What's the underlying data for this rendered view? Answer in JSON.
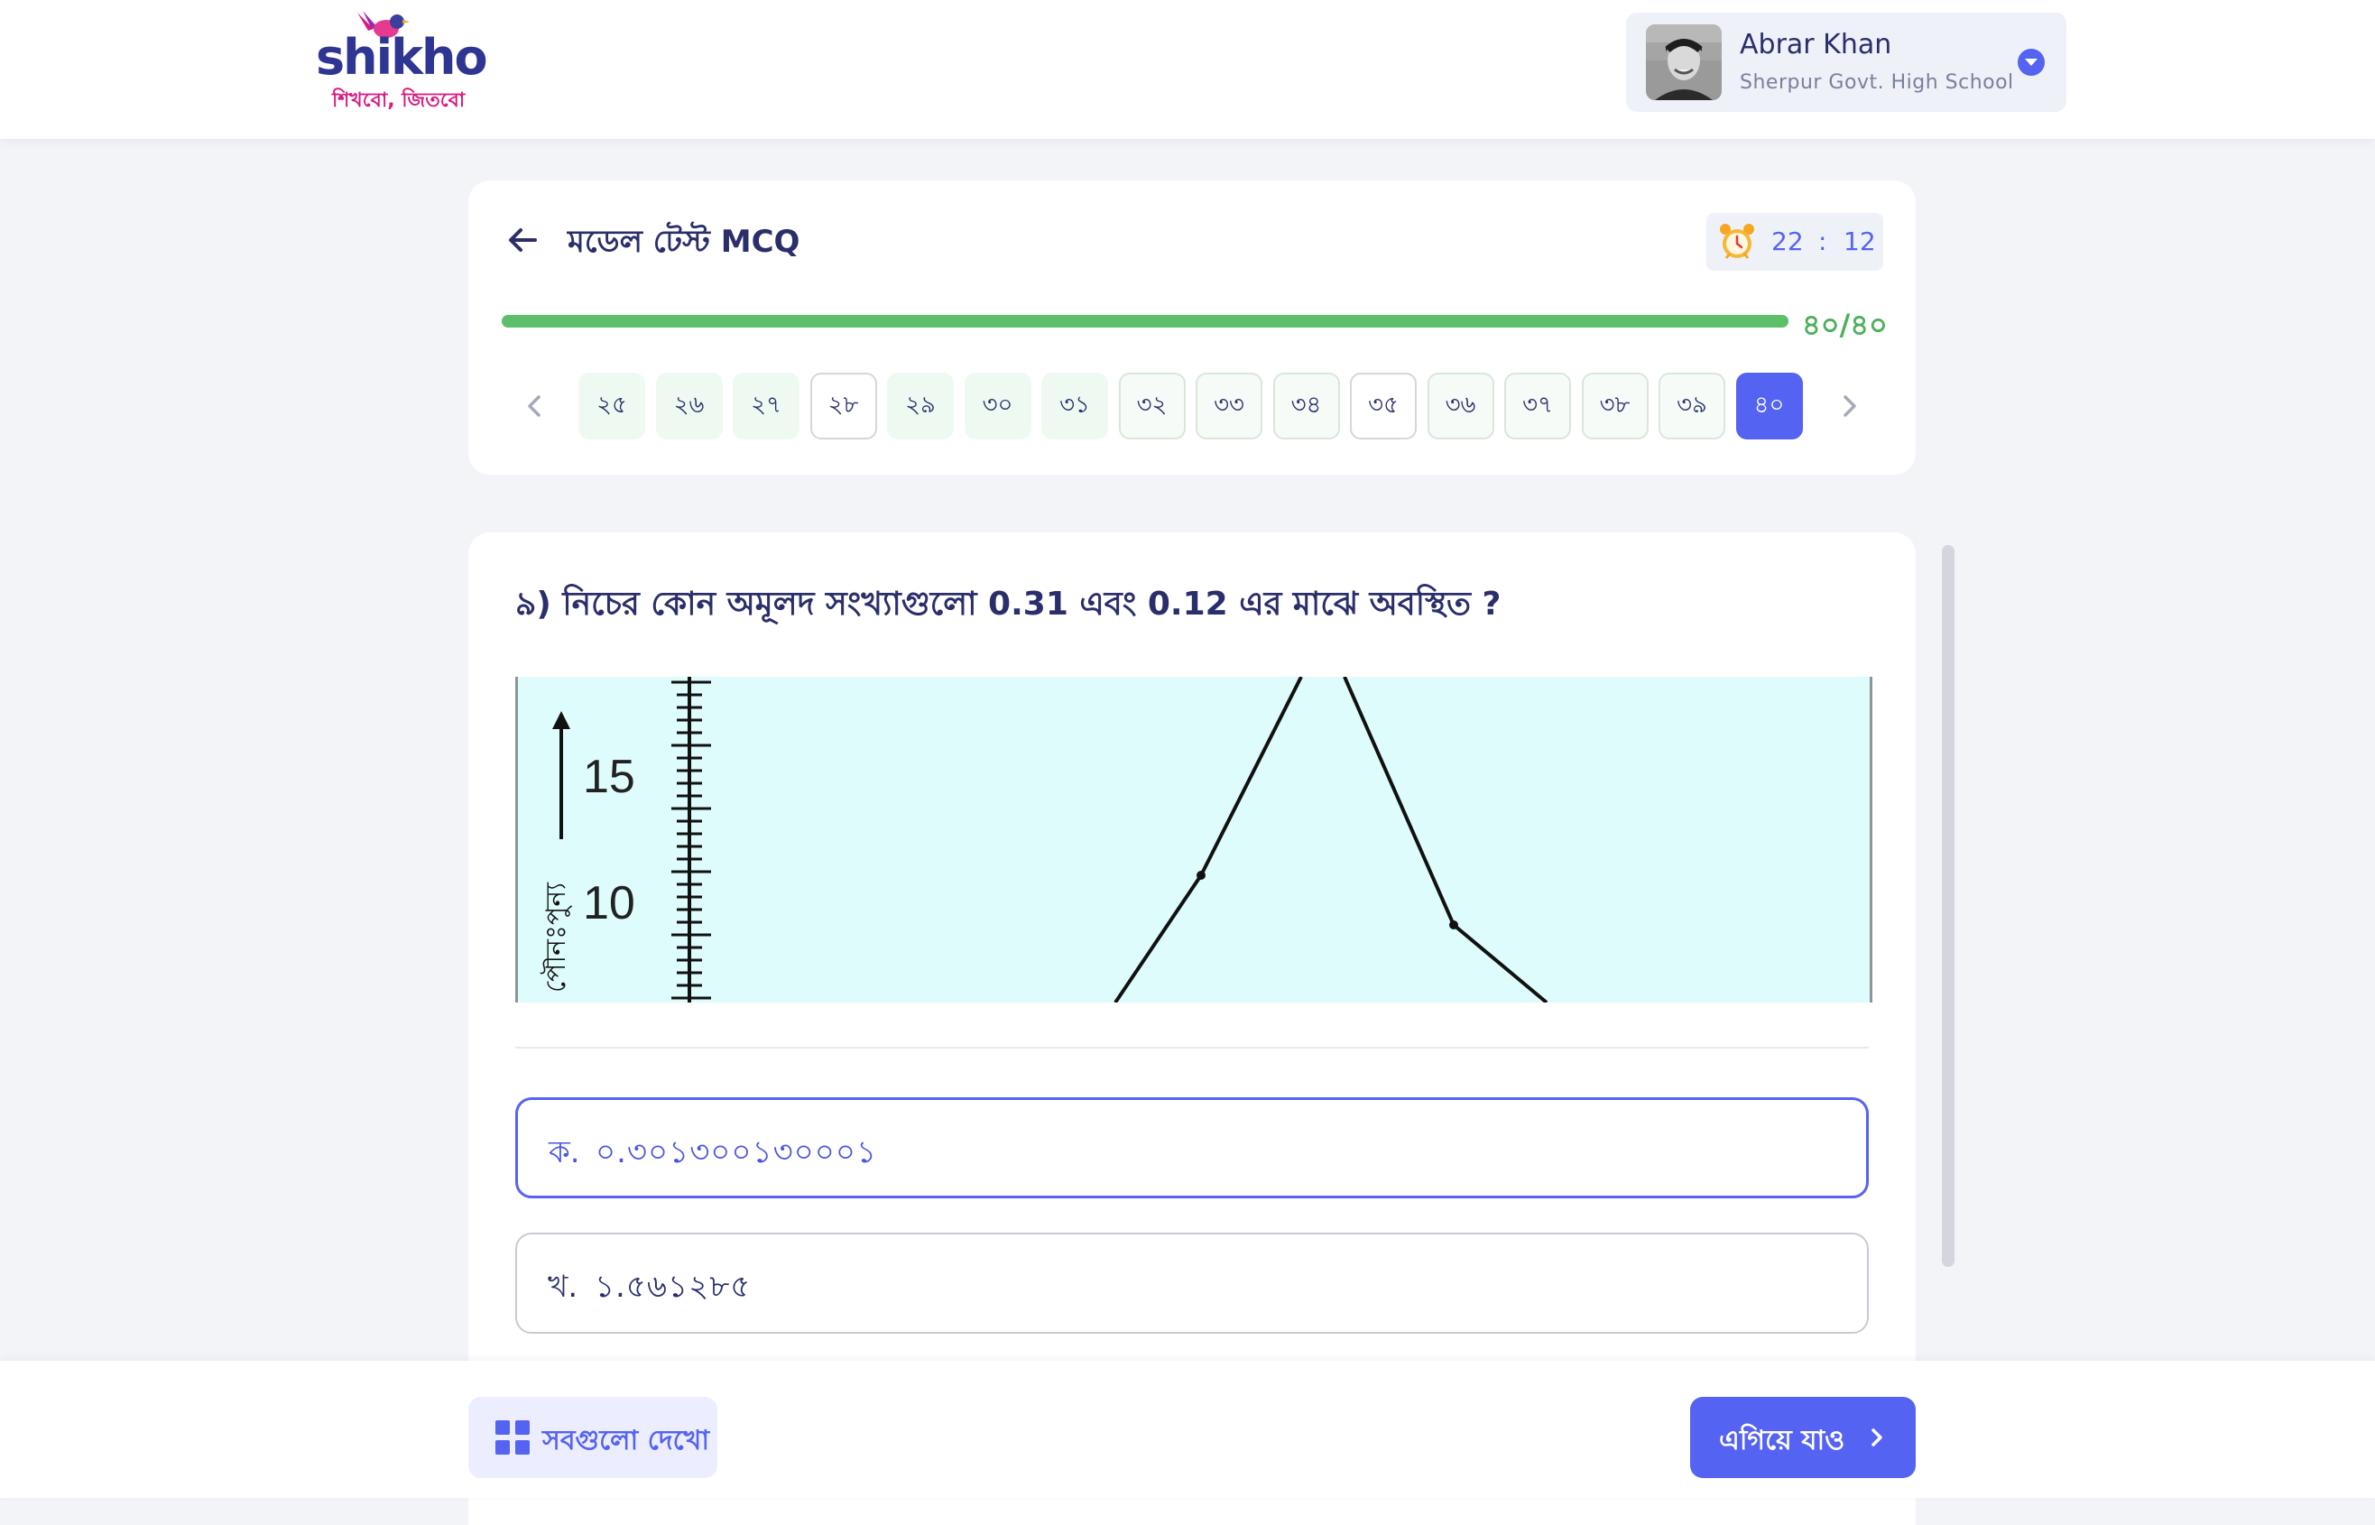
{
  "header": {
    "logo_text": "shikho",
    "logo_tagline": "শিখবো, জিতবো",
    "user_name": "Abrar Khan",
    "user_school": "Sherpur Govt. High School"
  },
  "test": {
    "title": "মডেল টেস্ট MCQ",
    "timer_minutes": "22",
    "timer_separator": ":",
    "timer_seconds": "12",
    "progress_text": "৪০/৪০",
    "progress_fraction": 1.0,
    "question_numbers": [
      {
        "label": "২৫",
        "state": "answered"
      },
      {
        "label": "২৬",
        "state": "answered"
      },
      {
        "label": "২৭",
        "state": "answered"
      },
      {
        "label": "২৮",
        "state": "plain"
      },
      {
        "label": "২৯",
        "state": "answered"
      },
      {
        "label": "৩০",
        "state": "answered"
      },
      {
        "label": "৩১",
        "state": "answered"
      },
      {
        "label": "৩২",
        "state": "visited"
      },
      {
        "label": "৩৩",
        "state": "visited"
      },
      {
        "label": "৩৪",
        "state": "visited"
      },
      {
        "label": "৩৫",
        "state": "plain"
      },
      {
        "label": "৩৬",
        "state": "visited"
      },
      {
        "label": "৩৭",
        "state": "visited"
      },
      {
        "label": "৩৮",
        "state": "visited"
      },
      {
        "label": "৩৯",
        "state": "visited"
      },
      {
        "label": "৪০",
        "state": "active"
      }
    ]
  },
  "question": {
    "text": "৯) নিচের কোন অমূলদ সংখ্যাগুলো 0.31 এবং 0.12 এর মাঝে অবস্থিত ?",
    "figure": {
      "tick_labels": [
        "15",
        "10"
      ],
      "axis_label": "পৌনঃপুন্য"
    },
    "options": [
      {
        "label": "ক.",
        "value": "০.৩০১৩০০১৩০০০১",
        "selected": true
      },
      {
        "label": "খ.",
        "value": "১.৫৬১২৮৫",
        "selected": false
      }
    ]
  },
  "footer": {
    "show_all_label": "সবগুলো দেখো",
    "next_label": "এগিয়ে যাও"
  },
  "colors": {
    "primary": "#5563f2",
    "title_text": "#2a2f6b",
    "progress_green": "#5dbf6a",
    "answered_bg": "#eefaf1",
    "figure_bg": "#dffcfd"
  },
  "icons": {
    "back": "arrow-left-icon",
    "timer": "alarm-clock-icon",
    "prev": "chevron-left-icon",
    "next": "chevron-right-icon",
    "grid": "grid-icon",
    "caret": "chevron-down-icon"
  }
}
